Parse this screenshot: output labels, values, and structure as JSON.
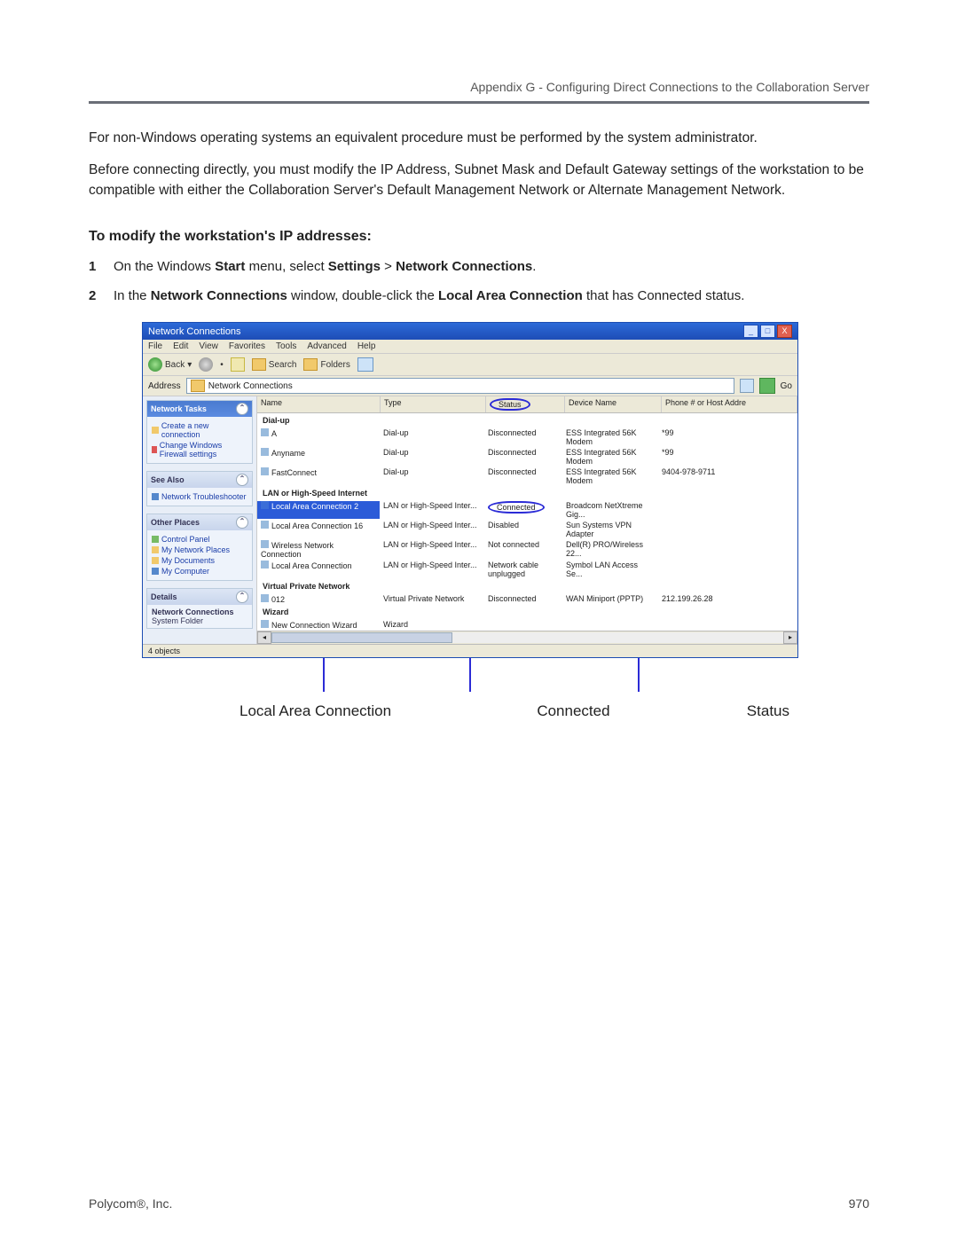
{
  "header": {
    "right": "Appendix G - Configuring Direct Connections to the Collaboration Server"
  },
  "paragraphs": {
    "p1": "For non-Windows operating systems an equivalent procedure must be performed by the system administrator.",
    "p2_pre": "Before connecting directly, you must modify the IP Address, Subnet Mask and Default Gateway settings of the workstation to be compatible with either the Collaboration Server's Default Management Network or Alternate Management Network."
  },
  "section_heading": "To modify the workstation's IP addresses:",
  "steps": {
    "s1": {
      "num": "1",
      "pre": "On the Windows ",
      "b1": "Start",
      "mid1": " menu, select ",
      "b2": "Settings",
      "mid2": " > ",
      "b3": "Network Connections",
      "post": "."
    },
    "s2": {
      "num": "2",
      "pre": "In the ",
      "b1": "Network Connections",
      "mid1": " window, double-click the ",
      "b2": "Local Area Connection",
      "post": " that has Connected status."
    }
  },
  "win": {
    "title": "Network Connections",
    "titlebar_min": "_",
    "titlebar_max": "□",
    "titlebar_close": "X",
    "menu": {
      "file": "File",
      "edit": "Edit",
      "view": "View",
      "fav": "Favorites",
      "tools": "Tools",
      "adv": "Advanced",
      "help": "Help"
    },
    "toolbar": {
      "back": "Back",
      "sep": "•",
      "search": "Search",
      "folders": "Folders"
    },
    "address": {
      "label": "Address",
      "value": "Network Connections",
      "go": "Go"
    },
    "sidebar": {
      "network_tasks": {
        "head": "Network Tasks",
        "i1": "Create a new connection",
        "i2": "Change Windows Firewall settings"
      },
      "see_also": {
        "head": "See Also",
        "i1": "Network Troubleshooter"
      },
      "other_places": {
        "head": "Other Places",
        "i1": "Control Panel",
        "i2": "My Network Places",
        "i3": "My Documents",
        "i4": "My Computer"
      },
      "details": {
        "head": "Details",
        "l1": "Network Connections",
        "l2": "System Folder"
      }
    },
    "columns": {
      "name": "Name",
      "type": "Type",
      "status": "Status",
      "device": "Device Name",
      "phone": "Phone # or Host Addre"
    },
    "groups": {
      "dialup": {
        "label": "Dial-up",
        "rows": [
          {
            "name": "A",
            "type": "Dial-up",
            "status": "Disconnected",
            "device": "ESS Integrated 56K Modem",
            "phone": "*99"
          },
          {
            "name": "Anyname",
            "type": "Dial-up",
            "status": "Disconnected",
            "device": "ESS Integrated 56K Modem",
            "phone": "*99"
          },
          {
            "name": "FastConnect",
            "type": "Dial-up",
            "status": "Disconnected",
            "device": "ESS Integrated 56K Modem",
            "phone": "9404-978-9711"
          }
        ]
      },
      "lan": {
        "label": "LAN or High-Speed Internet",
        "rows": [
          {
            "name": "Local Area Connection 2",
            "type": "LAN or High-Speed Inter...",
            "status": "Connected",
            "device": "Broadcom NetXtreme Gig...",
            "phone": "",
            "selected": true,
            "status_circled": true
          },
          {
            "name": "Local Area Connection 16",
            "type": "LAN or High-Speed Inter...",
            "status": "Disabled",
            "device": "Sun Systems VPN Adapter",
            "phone": ""
          },
          {
            "name": "Wireless Network Connection",
            "type": "LAN or High-Speed Inter...",
            "status": "Not connected",
            "device": "Dell(R) PRO/Wireless 22...",
            "phone": ""
          },
          {
            "name": "Local Area Connection",
            "type": "LAN or High-Speed Inter...",
            "status": "Network cable unplugged",
            "device": "Symbol LAN Access Se...",
            "phone": ""
          }
        ]
      },
      "vpn": {
        "label": "Virtual Private Network",
        "rows": [
          {
            "name": "012",
            "type": "Virtual Private Network",
            "status": "Disconnected",
            "device": "WAN Miniport (PPTP)",
            "phone": "212.199.26.28"
          }
        ]
      },
      "wizard": {
        "label": "Wizard",
        "rows": [
          {
            "name": "New Connection Wizard",
            "type": "Wizard",
            "status": "",
            "device": "",
            "phone": ""
          }
        ]
      }
    },
    "statusbar": "4 objects",
    "scroll_left": "◂",
    "scroll_right": "▸"
  },
  "captions": {
    "c1": "Local Area Connection",
    "c2": "Connected",
    "c3": "Status"
  },
  "footer": {
    "left": "Polycom®, Inc.",
    "right": "970"
  }
}
